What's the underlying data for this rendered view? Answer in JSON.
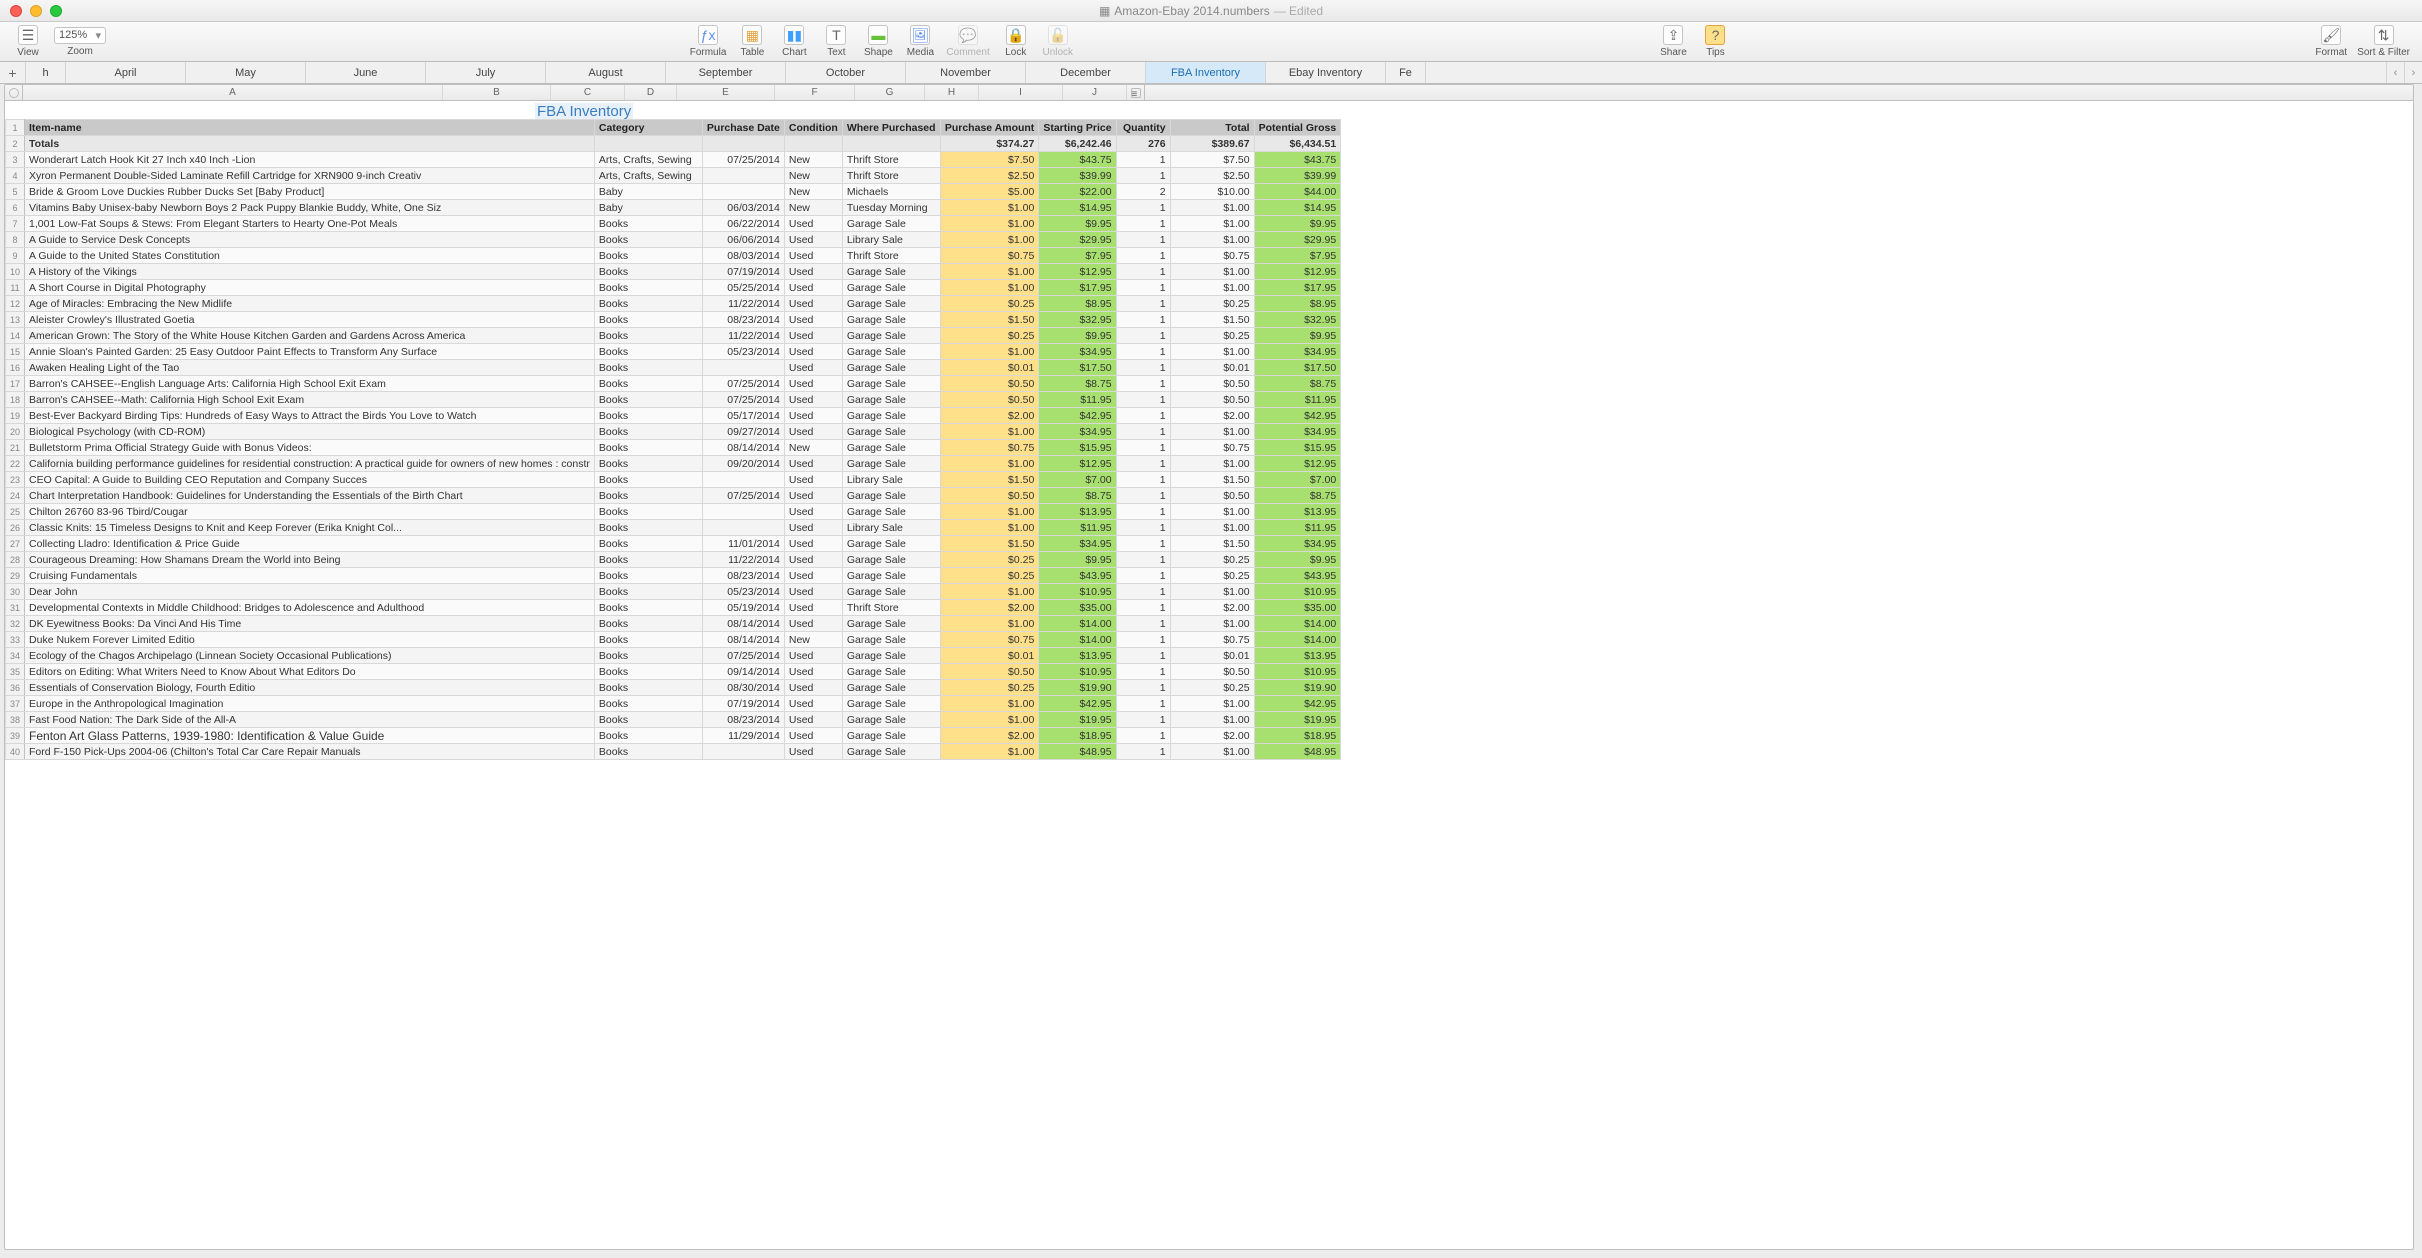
{
  "window": {
    "title": "Amazon-Ebay 2014.numbers",
    "edited": "— Edited"
  },
  "toolbar": {
    "zoom_value": "125%",
    "view": "View",
    "zoom": "Zoom",
    "formula": "Formula",
    "table": "Table",
    "chart": "Chart",
    "text": "Text",
    "shape": "Shape",
    "media": "Media",
    "comment": "Comment",
    "lock": "Lock",
    "unlock": "Unlock",
    "share": "Share",
    "tips": "Tips",
    "format": "Format",
    "sortfilter": "Sort & Filter"
  },
  "tabs": [
    "h",
    "April",
    "May",
    "June",
    "July",
    "August",
    "September",
    "October",
    "November",
    "December",
    "FBA Inventory",
    "Ebay Inventory",
    "Fe"
  ],
  "active_tab": 10,
  "col_letters": [
    "A",
    "B",
    "C",
    "D",
    "E",
    "F",
    "G",
    "H",
    "I",
    "J"
  ],
  "sheet_title": "FBA Inventory",
  "headers": [
    "Item-name",
    "Category",
    "Purchase Date",
    "Condition",
    "Where Purchased",
    "Purchase Amount",
    "Starting Price",
    "Quantity",
    "Total",
    "Potential Gross"
  ],
  "totals": {
    "label": "Totals",
    "purchase": "$374.27",
    "starting": "$6,242.46",
    "qty": "276",
    "total": "$389.67",
    "gross": "$6,434.51"
  },
  "rows": [
    {
      "n": 3,
      "item": "Wonderart Latch Hook Kit 27 Inch x40 Inch -Lion",
      "cat": "Arts, Crafts, Sewing",
      "date": "07/25/2014",
      "cond": "New",
      "where": "Thrift Store",
      "pa": "$7.50",
      "sp": "$43.75",
      "q": "1",
      "tot": "$7.50",
      "pg": "$43.75"
    },
    {
      "n": 4,
      "item": "Xyron Permanent Double-Sided Laminate Refill Cartridge for XRN900 9-inch Creativ",
      "cat": "Arts, Crafts, Sewing",
      "date": "",
      "cond": "New",
      "where": "Thrift Store",
      "pa": "$2.50",
      "sp": "$39.99",
      "q": "1",
      "tot": "$2.50",
      "pg": "$39.99"
    },
    {
      "n": 5,
      "item": "Bride & Groom Love Duckies Rubber Ducks Set [Baby Product]",
      "cat": "Baby",
      "date": "",
      "cond": "New",
      "where": "Michaels",
      "pa": "$5.00",
      "sp": "$22.00",
      "q": "2",
      "tot": "$10.00",
      "pg": "$44.00"
    },
    {
      "n": 6,
      "item": "Vitamins Baby Unisex-baby Newborn Boys 2 Pack Puppy Blankie Buddy, White, One Siz",
      "cat": "Baby",
      "date": "06/03/2014",
      "cond": "New",
      "where": "Tuesday Morning",
      "pa": "$1.00",
      "sp": "$14.95",
      "q": "1",
      "tot": "$1.00",
      "pg": "$14.95"
    },
    {
      "n": 7,
      "item": "1,001 Low-Fat Soups & Stews: From Elegant Starters to Hearty One-Pot Meals",
      "cat": "Books",
      "date": "06/22/2014",
      "cond": "Used",
      "where": "Garage Sale",
      "pa": "$1.00",
      "sp": "$9.95",
      "q": "1",
      "tot": "$1.00",
      "pg": "$9.95"
    },
    {
      "n": 8,
      "item": "A Guide to Service Desk Concepts",
      "cat": "Books",
      "date": "06/06/2014",
      "cond": "Used",
      "where": "Library Sale",
      "pa": "$1.00",
      "sp": "$29.95",
      "q": "1",
      "tot": "$1.00",
      "pg": "$29.95"
    },
    {
      "n": 9,
      "item": "A Guide to the United States Constitution",
      "cat": "Books",
      "date": "08/03/2014",
      "cond": "Used",
      "where": "Thrift Store",
      "pa": "$0.75",
      "sp": "$7.95",
      "q": "1",
      "tot": "$0.75",
      "pg": "$7.95"
    },
    {
      "n": 10,
      "item": "A History of the Vikings",
      "cat": "Books",
      "date": "07/19/2014",
      "cond": "Used",
      "where": "Garage Sale",
      "pa": "$1.00",
      "sp": "$12.95",
      "q": "1",
      "tot": "$1.00",
      "pg": "$12.95"
    },
    {
      "n": 11,
      "item": "A Short Course in Digital Photography",
      "cat": "Books",
      "date": "05/25/2014",
      "cond": "Used",
      "where": "Garage Sale",
      "pa": "$1.00",
      "sp": "$17.95",
      "q": "1",
      "tot": "$1.00",
      "pg": "$17.95"
    },
    {
      "n": 12,
      "item": "Age of Miracles: Embracing the New Midlife",
      "cat": "Books",
      "date": "11/22/2014",
      "cond": "Used",
      "where": "Garage Sale",
      "pa": "$0.25",
      "sp": "$8.95",
      "q": "1",
      "tot": "$0.25",
      "pg": "$8.95"
    },
    {
      "n": 13,
      "item": "Aleister Crowley's Illustrated Goetia",
      "cat": "Books",
      "date": "08/23/2014",
      "cond": "Used",
      "where": "Garage Sale",
      "pa": "$1.50",
      "sp": "$32.95",
      "q": "1",
      "tot": "$1.50",
      "pg": "$32.95"
    },
    {
      "n": 14,
      "item": "American Grown: The Story of the White House Kitchen Garden and Gardens Across America",
      "cat": "Books",
      "date": "11/22/2014",
      "cond": "Used",
      "where": "Garage Sale",
      "pa": "$0.25",
      "sp": "$9.95",
      "q": "1",
      "tot": "$0.25",
      "pg": "$9.95"
    },
    {
      "n": 15,
      "item": "Annie Sloan's Painted Garden: 25 Easy Outdoor Paint Effects to Transform Any Surface",
      "cat": "Books",
      "date": "05/23/2014",
      "cond": "Used",
      "where": "Garage Sale",
      "pa": "$1.00",
      "sp": "$34.95",
      "q": "1",
      "tot": "$1.00",
      "pg": "$34.95"
    },
    {
      "n": 16,
      "item": "Awaken Healing Light of the Tao",
      "cat": "Books",
      "date": "",
      "cond": "Used",
      "where": "Garage Sale",
      "pa": "$0.01",
      "sp": "$17.50",
      "q": "1",
      "tot": "$0.01",
      "pg": "$17.50"
    },
    {
      "n": 17,
      "item": "Barron's CAHSEE--English Language Arts: California High School Exit Exam",
      "cat": "Books",
      "date": "07/25/2014",
      "cond": "Used",
      "where": "Garage Sale",
      "pa": "$0.50",
      "sp": "$8.75",
      "q": "1",
      "tot": "$0.50",
      "pg": "$8.75"
    },
    {
      "n": 18,
      "item": "Barron's CAHSEE--Math: California High School Exit Exam",
      "cat": "Books",
      "date": "07/25/2014",
      "cond": "Used",
      "where": "Garage Sale",
      "pa": "$0.50",
      "sp": "$11.95",
      "q": "1",
      "tot": "$0.50",
      "pg": "$11.95"
    },
    {
      "n": 19,
      "item": "Best-Ever Backyard Birding Tips: Hundreds of Easy Ways to Attract the Birds You Love to Watch",
      "cat": "Books",
      "date": "05/17/2014",
      "cond": "Used",
      "where": "Garage Sale",
      "pa": "$2.00",
      "sp": "$42.95",
      "q": "1",
      "tot": "$2.00",
      "pg": "$42.95"
    },
    {
      "n": 20,
      "item": "Biological Psychology (with CD-ROM)",
      "cat": "Books",
      "date": "09/27/2014",
      "cond": "Used",
      "where": "Garage Sale",
      "pa": "$1.00",
      "sp": "$34.95",
      "q": "1",
      "tot": "$1.00",
      "pg": "$34.95"
    },
    {
      "n": 21,
      "item": "Bulletstorm Prima Official Strategy Guide with Bonus Videos:",
      "cat": "Books",
      "date": "08/14/2014",
      "cond": "New",
      "where": "Garage Sale",
      "pa": "$0.75",
      "sp": "$15.95",
      "q": "1",
      "tot": "$0.75",
      "pg": "$15.95"
    },
    {
      "n": 22,
      "item": "California building performance guidelines for residential construction: A practical guide for owners of new homes : constr",
      "cat": "Books",
      "date": "09/20/2014",
      "cond": "Used",
      "where": "Garage Sale",
      "pa": "$1.00",
      "sp": "$12.95",
      "q": "1",
      "tot": "$1.00",
      "pg": "$12.95"
    },
    {
      "n": 23,
      "item": "CEO Capital: A Guide to Building CEO Reputation and Company Succes",
      "cat": "Books",
      "date": "",
      "cond": "Used",
      "where": "Library Sale",
      "pa": "$1.50",
      "sp": "$7.00",
      "q": "1",
      "tot": "$1.50",
      "pg": "$7.00"
    },
    {
      "n": 24,
      "item": "Chart Interpretation Handbook: Guidelines for Understanding the Essentials of the Birth Chart",
      "cat": "Books",
      "date": "07/25/2014",
      "cond": "Used",
      "where": "Garage Sale",
      "pa": "$0.50",
      "sp": "$8.75",
      "q": "1",
      "tot": "$0.50",
      "pg": "$8.75"
    },
    {
      "n": 25,
      "item": "Chilton 26760 83-96 Tbird/Cougar",
      "cat": "Books",
      "date": "",
      "cond": "Used",
      "where": "Garage Sale",
      "pa": "$1.00",
      "sp": "$13.95",
      "q": "1",
      "tot": "$1.00",
      "pg": "$13.95"
    },
    {
      "n": 26,
      "item": "Classic Knits: 15 Timeless Designs to Knit and Keep Forever (Erika Knight Col...",
      "cat": "Books",
      "date": "",
      "cond": "Used",
      "where": "Library Sale",
      "pa": "$1.00",
      "sp": "$11.95",
      "q": "1",
      "tot": "$1.00",
      "pg": "$11.95"
    },
    {
      "n": 27,
      "item": "Collecting Lladro: Identification & Price Guide",
      "cat": "Books",
      "date": "11/01/2014",
      "cond": "Used",
      "where": "Garage Sale",
      "pa": "$1.50",
      "sp": "$34.95",
      "q": "1",
      "tot": "$1.50",
      "pg": "$34.95"
    },
    {
      "n": 28,
      "item": "Courageous Dreaming: How Shamans Dream the World into Being",
      "cat": "Books",
      "date": "11/22/2014",
      "cond": "Used",
      "where": "Garage Sale",
      "pa": "$0.25",
      "sp": "$9.95",
      "q": "1",
      "tot": "$0.25",
      "pg": "$9.95"
    },
    {
      "n": 29,
      "item": "Cruising Fundamentals",
      "cat": "Books",
      "date": "08/23/2014",
      "cond": "Used",
      "where": "Garage Sale",
      "pa": "$0.25",
      "sp": "$43.95",
      "q": "1",
      "tot": "$0.25",
      "pg": "$43.95"
    },
    {
      "n": 30,
      "item": "Dear John",
      "cat": "Books",
      "date": "05/23/2014",
      "cond": "Used",
      "where": "Garage Sale",
      "pa": "$1.00",
      "sp": "$10.95",
      "q": "1",
      "tot": "$1.00",
      "pg": "$10.95"
    },
    {
      "n": 31,
      "item": "Developmental Contexts in Middle Childhood: Bridges to Adolescence and Adulthood",
      "cat": "Books",
      "date": "05/19/2014",
      "cond": "Used",
      "where": "Thrift Store",
      "pa": "$2.00",
      "sp": "$35.00",
      "q": "1",
      "tot": "$2.00",
      "pg": "$35.00"
    },
    {
      "n": 32,
      "item": "DK Eyewitness Books: Da Vinci And His Time",
      "cat": "Books",
      "date": "08/14/2014",
      "cond": "Used",
      "where": "Garage Sale",
      "pa": "$1.00",
      "sp": "$14.00",
      "q": "1",
      "tot": "$1.00",
      "pg": "$14.00"
    },
    {
      "n": 33,
      "item": "Duke Nukem Forever Limited Editio",
      "cat": "Books",
      "date": "08/14/2014",
      "cond": "New",
      "where": "Garage Sale",
      "pa": "$0.75",
      "sp": "$14.00",
      "q": "1",
      "tot": "$0.75",
      "pg": "$14.00"
    },
    {
      "n": 34,
      "item": "Ecology of the Chagos Archipelago (Linnean Society Occasional Publications)",
      "cat": "Books",
      "date": "07/25/2014",
      "cond": "Used",
      "where": "Garage Sale",
      "pa": "$0.01",
      "sp": "$13.95",
      "q": "1",
      "tot": "$0.01",
      "pg": "$13.95"
    },
    {
      "n": 35,
      "item": "Editors on Editing: What Writers Need to Know About What Editors Do",
      "cat": "Books",
      "date": "09/14/2014",
      "cond": "Used",
      "where": "Garage Sale",
      "pa": "$0.50",
      "sp": "$10.95",
      "q": "1",
      "tot": "$0.50",
      "pg": "$10.95"
    },
    {
      "n": 36,
      "item": "Essentials of Conservation Biology, Fourth Editio",
      "cat": "Books",
      "date": "08/30/2014",
      "cond": "Used",
      "where": "Garage Sale",
      "pa": "$0.25",
      "sp": "$19.90",
      "q": "1",
      "tot": "$0.25",
      "pg": "$19.90"
    },
    {
      "n": 37,
      "item": "Europe in the Anthropological Imagination",
      "cat": "Books",
      "date": "07/19/2014",
      "cond": "Used",
      "where": "Garage Sale",
      "pa": "$1.00",
      "sp": "$42.95",
      "q": "1",
      "tot": "$1.00",
      "pg": "$42.95"
    },
    {
      "n": 38,
      "item": "Fast Food Nation: The Dark Side of the All-A",
      "cat": "Books",
      "date": "08/23/2014",
      "cond": "Used",
      "where": "Garage Sale",
      "pa": "$1.00",
      "sp": "$19.95",
      "q": "1",
      "tot": "$1.00",
      "pg": "$19.95"
    },
    {
      "n": 39,
      "item": "Fenton Art Glass Patterns, 1939-1980: Identification & Value Guide",
      "cat": "Books",
      "date": "11/29/2014",
      "cond": "Used",
      "where": "Garage Sale",
      "pa": "$2.00",
      "sp": "$18.95",
      "q": "1",
      "tot": "$2.00",
      "pg": "$18.95",
      "big": true
    },
    {
      "n": 40,
      "item": "Ford F-150 Pick-Ups 2004-06 (Chilton's Total Car Care Repair Manuals",
      "cat": "Books",
      "date": "",
      "cond": "Used",
      "where": "Garage Sale",
      "pa": "$1.00",
      "sp": "$48.95",
      "q": "1",
      "tot": "$1.00",
      "pg": "$48.95"
    }
  ]
}
